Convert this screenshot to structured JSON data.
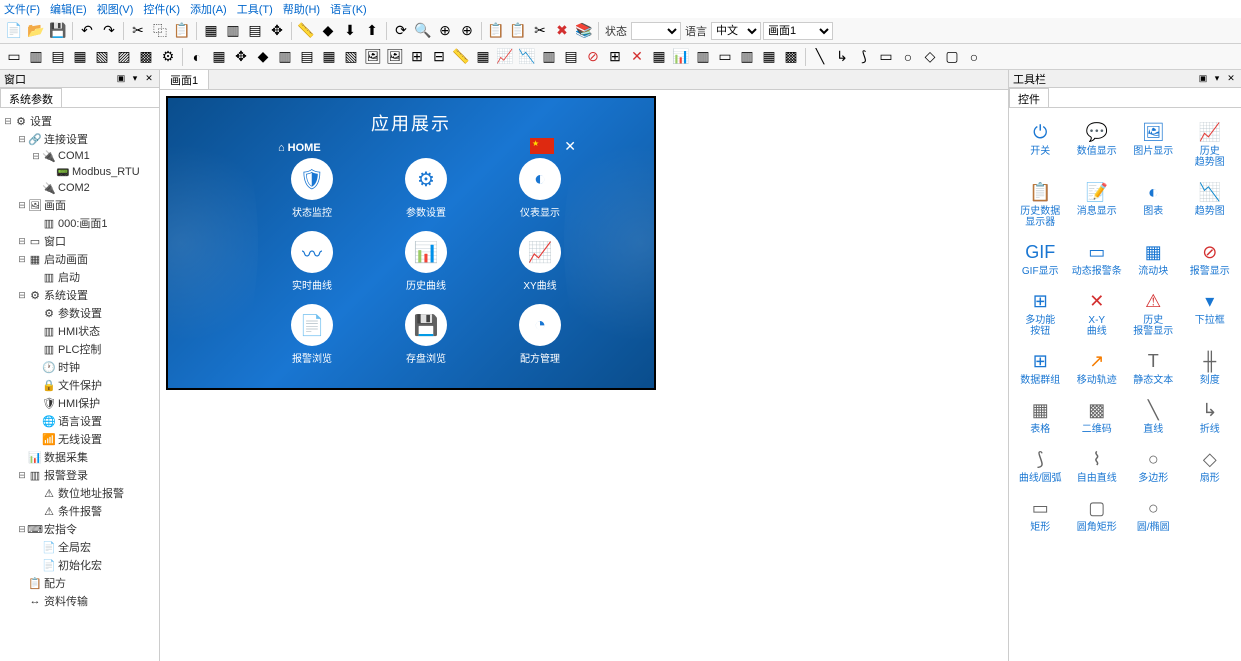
{
  "menu": {
    "file": "文件(F)",
    "edit": "编辑(E)",
    "view": "视图(V)",
    "widget": "控件(K)",
    "add": "添加(A)",
    "tools": "工具(T)",
    "help": "帮助(H)",
    "language": "语言(K)"
  },
  "toolbar": {
    "status_label": "状态",
    "status_value": "",
    "lang_label": "语言",
    "lang_value": "中文",
    "screen_label": "",
    "screen_value": "画面1"
  },
  "left_panel": {
    "title": "窗口",
    "tab": "系统参数",
    "tree": [
      {
        "level": 0,
        "exp": "⊟",
        "icon": "⚙",
        "label": "设置"
      },
      {
        "level": 1,
        "exp": "⊟",
        "icon": "🔗",
        "label": "连接设置"
      },
      {
        "level": 2,
        "exp": "⊟",
        "icon": "🔌",
        "label": "COM1"
      },
      {
        "level": 3,
        "exp": "",
        "icon": "📟",
        "label": "Modbus_RTU"
      },
      {
        "level": 2,
        "exp": "",
        "icon": "🔌",
        "label": "COM2"
      },
      {
        "level": 1,
        "exp": "⊟",
        "icon": "🖼",
        "label": "画面"
      },
      {
        "level": 2,
        "exp": "",
        "icon": "▥",
        "label": "000:画面1"
      },
      {
        "level": 1,
        "exp": "⊟",
        "icon": "▭",
        "label": "窗口"
      },
      {
        "level": 1,
        "exp": "⊟",
        "icon": "▦",
        "label": "启动画面"
      },
      {
        "level": 2,
        "exp": "",
        "icon": "▥",
        "label": "启动"
      },
      {
        "level": 1,
        "exp": "⊟",
        "icon": "⚙",
        "label": "系统设置"
      },
      {
        "level": 2,
        "exp": "",
        "icon": "⚙",
        "label": "参数设置"
      },
      {
        "level": 2,
        "exp": "",
        "icon": "▥",
        "label": "HMI状态"
      },
      {
        "level": 2,
        "exp": "",
        "icon": "▥",
        "label": "PLC控制"
      },
      {
        "level": 2,
        "exp": "",
        "icon": "🕐",
        "label": "时钟"
      },
      {
        "level": 2,
        "exp": "",
        "icon": "🔒",
        "label": "文件保护"
      },
      {
        "level": 2,
        "exp": "",
        "icon": "🛡",
        "label": "HMI保护"
      },
      {
        "level": 2,
        "exp": "",
        "icon": "🌐",
        "label": "语言设置"
      },
      {
        "level": 2,
        "exp": "",
        "icon": "📶",
        "label": "无线设置"
      },
      {
        "level": 1,
        "exp": "",
        "icon": "📊",
        "label": "数据采集"
      },
      {
        "level": 1,
        "exp": "⊟",
        "icon": "▥",
        "label": "报警登录"
      },
      {
        "level": 2,
        "exp": "",
        "icon": "⚠",
        "label": "数位地址报警"
      },
      {
        "level": 2,
        "exp": "",
        "icon": "⚠",
        "label": "条件报警"
      },
      {
        "level": 1,
        "exp": "⊟",
        "icon": "⌨",
        "label": "宏指令"
      },
      {
        "level": 2,
        "exp": "",
        "icon": "📄",
        "label": "全局宏"
      },
      {
        "level": 2,
        "exp": "",
        "icon": "📄",
        "label": "初始化宏"
      },
      {
        "level": 1,
        "exp": "",
        "icon": "📋",
        "label": "配方"
      },
      {
        "level": 1,
        "exp": "",
        "icon": "↔",
        "label": "资料传输"
      }
    ]
  },
  "canvas": {
    "tab": "画面1",
    "hmi": {
      "title": "应用展示",
      "home": "HOME",
      "items": [
        {
          "icon": "🛡",
          "label": "状态监控"
        },
        {
          "icon": "⚙",
          "label": "参数设置"
        },
        {
          "icon": "◐",
          "label": "仪表显示"
        },
        {
          "icon": "〰",
          "label": "实时曲线"
        },
        {
          "icon": "📊",
          "label": "历史曲线"
        },
        {
          "icon": "📈",
          "label": "XY曲线"
        },
        {
          "icon": "📄",
          "label": "报警浏览"
        },
        {
          "icon": "💾",
          "label": "存盘浏览"
        },
        {
          "icon": "◔",
          "label": "配方管理"
        }
      ]
    }
  },
  "right_panel": {
    "title": "工具栏",
    "tab": "控件",
    "widgets": [
      {
        "icon": "⏻",
        "label": "开关",
        "cls": ""
      },
      {
        "icon": "💬",
        "label": "数值显示",
        "cls": ""
      },
      {
        "icon": "🖼",
        "label": "图片显示",
        "cls": ""
      },
      {
        "icon": "📈",
        "label": "历史\n趋势图",
        "cls": "orange"
      },
      {
        "icon": "📋",
        "label": "历史数据\n显示器",
        "cls": ""
      },
      {
        "icon": "📝",
        "label": "消息显示",
        "cls": ""
      },
      {
        "icon": "◐",
        "label": "图表",
        "cls": ""
      },
      {
        "icon": "📉",
        "label": "趋势图",
        "cls": ""
      },
      {
        "icon": "GIF",
        "label": "GIF显示",
        "cls": ""
      },
      {
        "icon": "▭",
        "label": "动态报警条",
        "cls": ""
      },
      {
        "icon": "▦",
        "label": "流动块",
        "cls": ""
      },
      {
        "icon": "⊘",
        "label": "报警显示",
        "cls": "red"
      },
      {
        "icon": "⊞",
        "label": "多功能\n按钮",
        "cls": ""
      },
      {
        "icon": "✕",
        "label": "X-Y\n曲线",
        "cls": "red"
      },
      {
        "icon": "⚠",
        "label": "历史\n报警显示",
        "cls": "red"
      },
      {
        "icon": "▾",
        "label": "下拉框",
        "cls": ""
      },
      {
        "icon": "⊞",
        "label": "数据群组",
        "cls": ""
      },
      {
        "icon": "↗",
        "label": "移动轨迹",
        "cls": "orange"
      },
      {
        "icon": "T",
        "label": "静态文本",
        "cls": "gray"
      },
      {
        "icon": "╫",
        "label": "刻度",
        "cls": "gray"
      },
      {
        "icon": "▦",
        "label": "表格",
        "cls": "gray"
      },
      {
        "icon": "▩",
        "label": "二维码",
        "cls": "gray"
      },
      {
        "icon": "╲",
        "label": "直线",
        "cls": "gray"
      },
      {
        "icon": "↳",
        "label": "折线",
        "cls": "gray"
      },
      {
        "icon": "⟆",
        "label": "曲线/圆弧",
        "cls": "gray"
      },
      {
        "icon": "⌇",
        "label": "自由直线",
        "cls": "gray"
      },
      {
        "icon": "○",
        "label": "多边形",
        "cls": "gray"
      },
      {
        "icon": "◇",
        "label": "扇形",
        "cls": "gray"
      },
      {
        "icon": "▭",
        "label": "矩形",
        "cls": "gray"
      },
      {
        "icon": "▢",
        "label": "圆角矩形",
        "cls": "gray"
      },
      {
        "icon": "○",
        "label": "圆/椭圆",
        "cls": "gray"
      }
    ]
  }
}
